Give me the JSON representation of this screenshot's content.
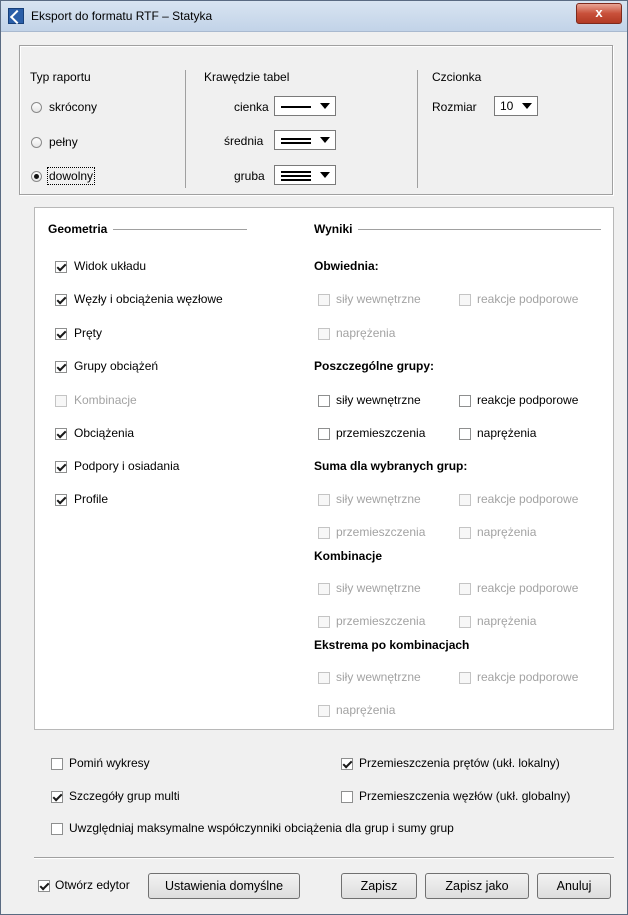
{
  "window": {
    "title": "Eksport do formatu RTF – Statyka",
    "close_label": "x"
  },
  "report_type": {
    "header": "Typ raportu",
    "options": [
      {
        "label": "skrócony",
        "selected": false
      },
      {
        "label": "pełny",
        "selected": false
      },
      {
        "label": "dowolny",
        "selected": true
      }
    ]
  },
  "table_edges": {
    "header": "Krawędzie tabel",
    "rows": [
      {
        "label": "cienka",
        "lines": 1
      },
      {
        "label": "średnia",
        "lines": 2
      },
      {
        "label": "gruba",
        "lines": 3
      }
    ]
  },
  "font": {
    "header": "Czcionka",
    "size_label": "Rozmiar",
    "size_value": "10"
  },
  "geometry": {
    "header": "Geometria",
    "items": [
      {
        "label": "Widok układu",
        "checked": true,
        "enabled": true
      },
      {
        "label": "Węzły i obciążenia węzłowe",
        "checked": true,
        "enabled": true
      },
      {
        "label": "Pręty",
        "checked": true,
        "enabled": true
      },
      {
        "label": "Grupy obciążeń",
        "checked": true,
        "enabled": true
      },
      {
        "label": "Kombinacje",
        "checked": false,
        "enabled": false
      },
      {
        "label": "Obciążenia",
        "checked": true,
        "enabled": true
      },
      {
        "label": "Podpory i osiadania",
        "checked": true,
        "enabled": true
      },
      {
        "label": "Profile",
        "checked": true,
        "enabled": true
      }
    ]
  },
  "results": {
    "header": "Wyniki",
    "groups": [
      {
        "title": "Obwiednia:",
        "items": [
          {
            "label": "siły wewnętrzne",
            "checked": false,
            "enabled": false
          },
          {
            "label": "reakcje podporowe",
            "checked": false,
            "enabled": false
          },
          {
            "label": "naprężenia",
            "checked": false,
            "enabled": false
          }
        ]
      },
      {
        "title": "Poszczególne grupy:",
        "items": [
          {
            "label": "siły wewnętrzne",
            "checked": false,
            "enabled": true
          },
          {
            "label": "reakcje podporowe",
            "checked": false,
            "enabled": true
          },
          {
            "label": "przemieszczenia",
            "checked": false,
            "enabled": true
          },
          {
            "label": "naprężenia",
            "checked": false,
            "enabled": true
          }
        ]
      },
      {
        "title": "Suma dla wybranych grup:",
        "items": [
          {
            "label": "siły wewnętrzne",
            "checked": false,
            "enabled": false
          },
          {
            "label": "reakcje podporowe",
            "checked": false,
            "enabled": false
          },
          {
            "label": "przemieszczenia",
            "checked": false,
            "enabled": false
          },
          {
            "label": "naprężenia",
            "checked": false,
            "enabled": false
          }
        ]
      },
      {
        "title": "Kombinacje",
        "items": [
          {
            "label": "siły wewnętrzne",
            "checked": false,
            "enabled": false
          },
          {
            "label": "reakcje podporowe",
            "checked": false,
            "enabled": false
          },
          {
            "label": "przemieszczenia",
            "checked": false,
            "enabled": false
          },
          {
            "label": "naprężenia",
            "checked": false,
            "enabled": false
          }
        ]
      },
      {
        "title": "Ekstrema po kombinacjach",
        "items": [
          {
            "label": "siły wewnętrzne",
            "checked": false,
            "enabled": false
          },
          {
            "label": "reakcje podporowe",
            "checked": false,
            "enabled": false
          },
          {
            "label": "naprężenia",
            "checked": false,
            "enabled": false
          }
        ]
      }
    ]
  },
  "options": {
    "skip_charts": {
      "label": "Pomiń wykresy",
      "checked": false
    },
    "bar_displacements": {
      "label": "Przemieszczenia prętów (ukł. lokalny)",
      "checked": true
    },
    "multi_group_details": {
      "label": "Szczegóły grup multi",
      "checked": true
    },
    "node_displacements": {
      "label": "Przemieszczenia węzłów (ukł. globalny)",
      "checked": false
    },
    "max_factors": {
      "label": "Uwzględniaj maksymalne współczynniki obciążenia dla grup i sumy grup",
      "checked": false
    }
  },
  "footer": {
    "open_editor": {
      "label": "Otwórz edytor",
      "checked": true
    },
    "defaults_button": "Ustawienia domyślne",
    "save_button": "Zapisz",
    "save_as_button": "Zapisz jako",
    "cancel_button": "Anuluj"
  }
}
